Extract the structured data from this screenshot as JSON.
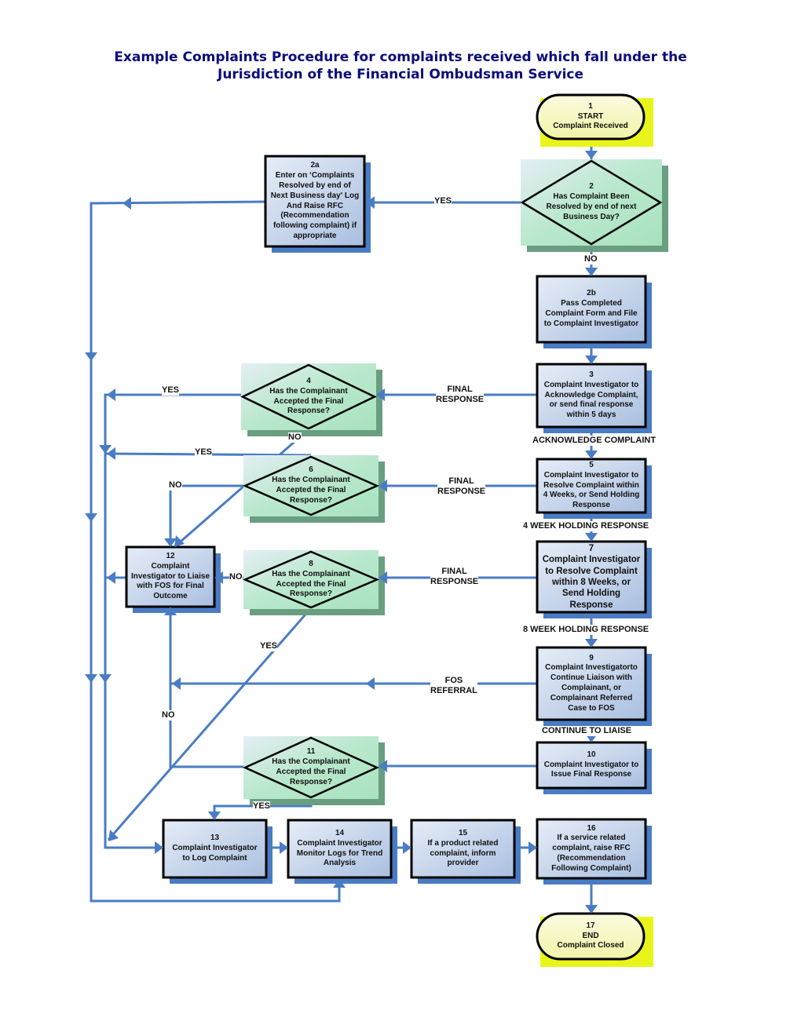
{
  "title": {
    "line1": "Example Complaints Procedure for complaints received which fall under the",
    "line2": "Jurisdiction of the Financial Ombudsman Service"
  },
  "colors": {
    "title": "#0c0c7a",
    "connector": "#4a7cc4",
    "terminal_fill": "#f6f7b6",
    "terminal_highlight": "#e8f51a",
    "process_fill": "#b8c9e4",
    "process_shadow": "#4a7cc4",
    "decision_fill": "#b4e6c8",
    "decision_shadow": "#6a9e80"
  },
  "nodes": {
    "n1": {
      "type": "terminal",
      "num": "1",
      "lines": [
        "START",
        "Complaint Received"
      ]
    },
    "n2": {
      "type": "decision",
      "num": "2",
      "lines": [
        "Has Complaint Been",
        "Resolved by end of next",
        "Business Day?"
      ]
    },
    "n2a": {
      "type": "process",
      "num": "2a",
      "lines": [
        "Enter on ‘Complaints",
        "Resolved by end of",
        "Next Business day' Log",
        "And Raise RFC",
        "(Recommendation",
        "following complaint) if",
        "appropriate"
      ]
    },
    "n2b": {
      "type": "process",
      "num": "2b",
      "lines": [
        "Pass Completed",
        "Complaint Form and File",
        "to Complaint Investigator"
      ]
    },
    "n3": {
      "type": "process",
      "num": "3",
      "lines": [
        "Complaint Investigator to",
        "Acknowledge Complaint,",
        "or send final response",
        "within 5 days"
      ]
    },
    "n4": {
      "type": "decision",
      "num": "4",
      "lines": [
        "Has the Complainant",
        "Accepted the Final",
        "Response?"
      ]
    },
    "n5": {
      "type": "process",
      "num": "5",
      "lines": [
        "Complaint Investigator to",
        "Resolve Complaint within",
        "4 Weeks, or Send Holding",
        "Response"
      ]
    },
    "n6": {
      "type": "decision",
      "num": "6",
      "lines": [
        "Has the Complainant",
        "Accepted the Final",
        "Response?"
      ]
    },
    "n7": {
      "type": "process",
      "num": "7",
      "lines": [
        "Complaint Investigator",
        "to Resolve Complaint",
        "within  8 Weeks, or",
        "Send Holding",
        "Response"
      ]
    },
    "n8": {
      "type": "decision",
      "num": "8",
      "lines": [
        "Has the Complainant",
        "Accepted the Final",
        "Response?"
      ]
    },
    "n9": {
      "type": "process",
      "num": "9",
      "lines": [
        "Complaint Investigatorto",
        "Continue Liaison with",
        "Complainant, or",
        "Complainant Referred",
        "Case to FOS"
      ]
    },
    "n10": {
      "type": "process",
      "num": "10",
      "lines": [
        "Complaint Investigator to",
        "Issue Final Response"
      ]
    },
    "n11": {
      "type": "decision",
      "num": "11",
      "lines": [
        "Has the Complainant",
        "Accepted the Final",
        "Response?"
      ]
    },
    "n12": {
      "type": "process",
      "num": "12",
      "lines": [
        "Complaint",
        "Investigator to Liaise",
        "with FOS for Final",
        "Outcome"
      ]
    },
    "n13": {
      "type": "process",
      "num": "13",
      "lines": [
        "Complaint Investigator",
        "to Log Complaint"
      ]
    },
    "n14": {
      "type": "process",
      "num": "14",
      "lines": [
        "Complaint Investigator",
        "Monitor Logs for Trend",
        "Analysis"
      ]
    },
    "n15": {
      "type": "process",
      "num": "15",
      "lines": [
        "If a product related",
        "complaint, inform",
        "provider"
      ]
    },
    "n16": {
      "type": "process",
      "num": "16",
      "lines": [
        "If a service related",
        "complaint, raise RFC",
        "(Recommendation",
        "Following Complaint)"
      ]
    },
    "n17": {
      "type": "terminal",
      "num": "17",
      "lines": [
        "END",
        "Complaint Closed"
      ]
    }
  },
  "edge_labels": {
    "n2_yes": "YES",
    "n2_no": "NO",
    "n3_final": [
      "FINAL",
      "RESPONSE"
    ],
    "n3_ack": "ACKNOWLEDGE COMPLAINT",
    "n4_yes": "YES",
    "n4_no": "NO",
    "n5_final": [
      "FINAL",
      "RESPONSE"
    ],
    "n5_holding": "4 WEEK HOLDING RESPONSE",
    "n6_yes": "YES",
    "n6_no": "NO",
    "n7_final": [
      "FINAL",
      "RESPONSE"
    ],
    "n7_holding": "8 WEEK HOLDING RESPONSE",
    "n8_no": "NO",
    "n8_yes": "YES",
    "n9_fos": [
      "FOS",
      "REFERRAL"
    ],
    "n9_continue": "CONTINUE TO LIAISE",
    "n11_no": "NO",
    "n11_yes": "YES"
  }
}
